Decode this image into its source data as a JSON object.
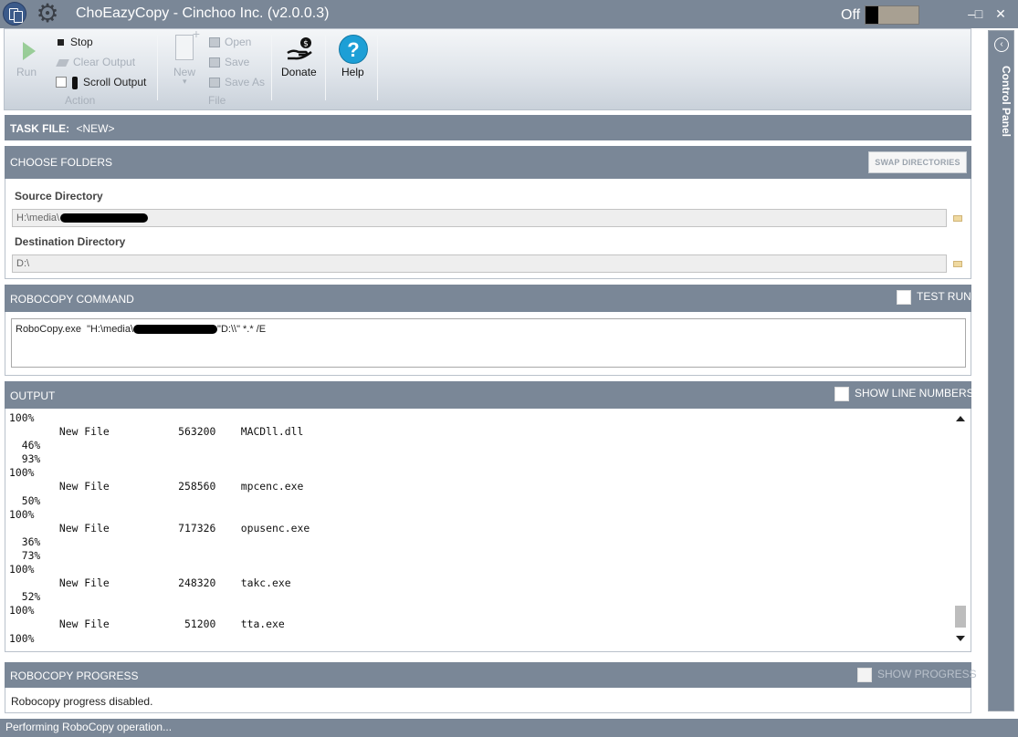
{
  "window": {
    "title": "ChoEazyCopy - Cinchoo Inc. (v2.0.0.3)",
    "toggle_label": "Off",
    "minimize_glyph": "–",
    "maximize_glyph": "□",
    "close_glyph": "✕"
  },
  "ribbon": {
    "run_label": "Run",
    "stop_label": "Stop",
    "clear_output_label": "Clear Output",
    "scroll_output_label": "Scroll Output",
    "action_group_label": "Action",
    "new_label": "New",
    "new_arrow": "▾",
    "open_label": "Open",
    "save_label": "Save",
    "save_as_label": "Save As",
    "file_group_label": "File",
    "donate_label": "Donate",
    "help_label": "Help",
    "help_glyph": "?"
  },
  "task_file": {
    "label": "TASK FILE:",
    "value": "<NEW>"
  },
  "choose_folders": {
    "header": "CHOOSE FOLDERS",
    "swap_label": "SWAP DIRECTORIES",
    "source_label": "Source Directory",
    "source_value": "H:\\media\\",
    "destination_label": "Destination Directory",
    "destination_value": "D:\\"
  },
  "robocopy_command": {
    "header": "ROBOCOPY COMMAND",
    "test_run_label": "TEST RUN",
    "command_prefix": "RoboCopy.exe  \"H:\\media\\",
    "command_suffix": "\"D:\\\\\" *.* /E"
  },
  "output": {
    "header": "OUTPUT",
    "show_line_numbers_label": "SHOW LINE NUMBERS",
    "lines": [
      "100%",
      "        New File           563200    MACDll.dll",
      "  46%",
      "  93%",
      "100%",
      "        New File           258560    mpcenc.exe",
      "  50%",
      "100%",
      "        New File           717326    opusenc.exe",
      "  36%",
      "  73%",
      "100%",
      "        New File           248320    takc.exe",
      "  52%",
      "100%",
      "        New File            51200    tta.exe",
      "100%"
    ]
  },
  "progress": {
    "header": "ROBOCOPY PROGRESS",
    "show_progress_label": "SHOW PROGRESS",
    "message": "Robocopy progress disabled."
  },
  "status": {
    "text": "Performing RoboCopy operation..."
  },
  "control_panel": {
    "label": "Control Panel",
    "collapse_glyph": "‹"
  },
  "colors": {
    "header_bar": "#7a8797",
    "help_blue": "#1d9fd6",
    "run_green": "#7ec27a"
  }
}
